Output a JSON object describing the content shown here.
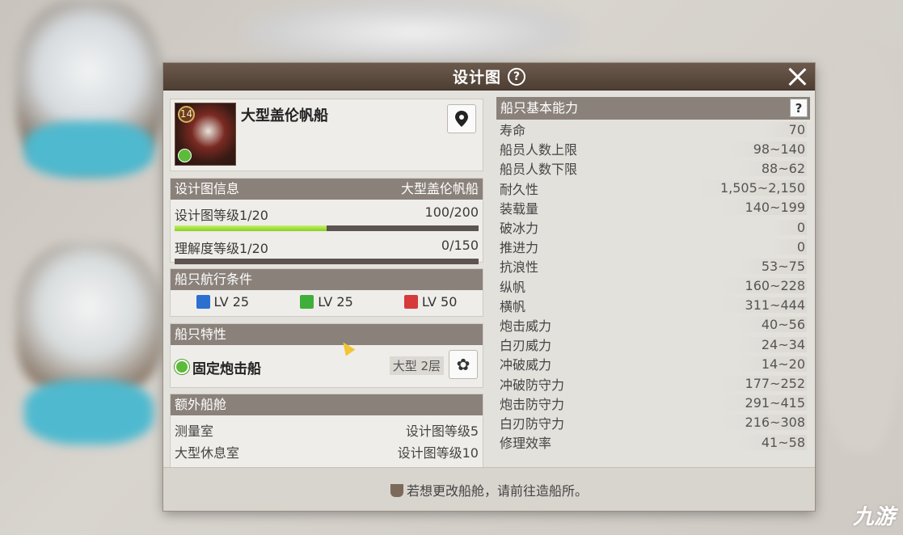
{
  "dialog": {
    "title": "设计图"
  },
  "ship": {
    "name": "大型盖伦帆船",
    "level": "14"
  },
  "blueprint_info": {
    "header_left": "设计图信息",
    "header_right": "大型盖伦帆船",
    "level_label": "设计图等级1/20",
    "level_progress": "100/200",
    "level_fraction": 0.5,
    "understanding_label": "理解度等级1/20",
    "understanding_progress": "0/150",
    "understanding_fraction": 0
  },
  "conditions": {
    "header": "船只航行条件",
    "items": [
      {
        "label": "LV 25",
        "color": "#2b6fd1"
      },
      {
        "label": "LV 25",
        "color": "#3fae3a"
      },
      {
        "label": "LV 50",
        "color": "#d63a3a"
      }
    ]
  },
  "traits": {
    "header": "船只特性",
    "name": "固定炮击船",
    "size": "大型 2层"
  },
  "extra_rooms": {
    "header": "额外船舱",
    "rows": [
      {
        "name": "测量室",
        "req": "设计图等级5"
      },
      {
        "name": "大型休息室",
        "req": "设计图等级10"
      }
    ]
  },
  "abilities": {
    "header": "船只基本能力",
    "help": "?",
    "stats": [
      {
        "name": "寿命",
        "value": "70"
      },
      {
        "name": "船员人数上限",
        "value": "98~140"
      },
      {
        "name": "船员人数下限",
        "value": "88~62"
      },
      {
        "name": "耐久性",
        "value": "1,505~2,150"
      },
      {
        "name": "装载量",
        "value": "140~199"
      },
      {
        "name": "破冰力",
        "value": "0"
      },
      {
        "name": "推进力",
        "value": "0"
      },
      {
        "name": "抗浪性",
        "value": "53~75"
      },
      {
        "name": "纵帆",
        "value": "160~228"
      },
      {
        "name": "横帆",
        "value": "311~444"
      },
      {
        "name": "炮击威力",
        "value": "40~56"
      },
      {
        "name": "白刃威力",
        "value": "24~34"
      },
      {
        "name": "冲破威力",
        "value": "14~20"
      },
      {
        "name": "冲破防守力",
        "value": "177~252"
      },
      {
        "name": "炮击防守力",
        "value": "291~415"
      },
      {
        "name": "白刃防守力",
        "value": "216~308"
      },
      {
        "name": "修理效率",
        "value": "41~58"
      }
    ]
  },
  "footer": {
    "text": "若想更改船舱，请前往造船所。"
  },
  "watermark": "九游"
}
